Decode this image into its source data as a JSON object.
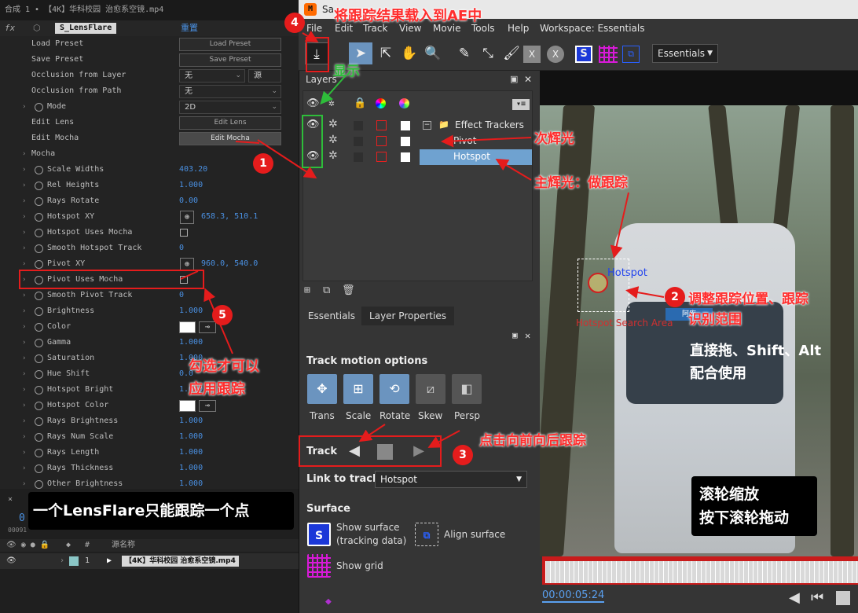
{
  "ae": {
    "top_bar": "合成 1 • 【4K】华科校园 治愈系空镜.mp4",
    "fx_label": "fx",
    "effect_name": "S_LensFlare",
    "reset": "重置",
    "rows": [
      {
        "label": "Load Preset",
        "type": "button",
        "button": "Load Preset"
      },
      {
        "label": "Save Preset",
        "type": "button",
        "button": "Save Preset"
      },
      {
        "label": "Occlusion from Layer",
        "type": "select2",
        "value": "无",
        "value2": "源"
      },
      {
        "label": "Occlusion from Path",
        "type": "select",
        "value": "无"
      },
      {
        "label": "Mode",
        "type": "select",
        "value": "2D",
        "stopwatch": true
      },
      {
        "label": "Edit Lens",
        "type": "button",
        "button": "Edit Lens"
      },
      {
        "label": "Edit Mocha",
        "type": "button-light",
        "button": "Edit Mocha"
      },
      {
        "label": "Mocha",
        "type": "group"
      },
      {
        "label": "Scale Widths",
        "type": "value",
        "value": "403.20"
      },
      {
        "label": "Rel Heights",
        "type": "value",
        "value": "1.000"
      },
      {
        "label": "Rays Rotate",
        "type": "value",
        "value": "0.00"
      },
      {
        "label": "Hotspot XY",
        "type": "point",
        "value": "658.3, 510.1"
      },
      {
        "label": "Hotspot Uses Mocha",
        "type": "checkbox"
      },
      {
        "label": "Smooth Hotspot Track",
        "type": "value",
        "value": "0"
      },
      {
        "label": "Pivot XY",
        "type": "point",
        "value": "960.0, 540.0"
      },
      {
        "label": "Pivot Uses Mocha",
        "type": "checkbox"
      },
      {
        "label": "Smooth Pivot Track",
        "type": "value",
        "value": "0"
      },
      {
        "label": "Brightness",
        "type": "value",
        "value": "1.000"
      },
      {
        "label": "Color",
        "type": "color"
      },
      {
        "label": "Gamma",
        "type": "value",
        "value": "1.000"
      },
      {
        "label": "Saturation",
        "type": "value",
        "value": "1.000"
      },
      {
        "label": "Hue Shift",
        "type": "value",
        "value": "0.0"
      },
      {
        "label": "Hotspot Bright",
        "type": "value",
        "value": "1.000"
      },
      {
        "label": "Hotspot Color",
        "type": "color"
      },
      {
        "label": "Rays Brightness",
        "type": "value",
        "value": "1.000"
      },
      {
        "label": "Rays Num Scale",
        "type": "value",
        "value": "1.000"
      },
      {
        "label": "Rays Length",
        "type": "value",
        "value": "1.000"
      },
      {
        "label": "Rays Thickness",
        "type": "value",
        "value": "1.000"
      },
      {
        "label": "Other Brightness",
        "type": "value",
        "value": "1.000"
      }
    ],
    "bottom_close": "×",
    "timecode": "0",
    "small_tc": "00091",
    "layer_header_name": "源名称",
    "layer_header_hash": "#",
    "layer_num": "1",
    "layer_name": "【4K】华科校园 治愈系空镜.mp4"
  },
  "mocha": {
    "logo": "M",
    "title": "Sa",
    "menu": [
      "File",
      "Edit",
      "Track",
      "View",
      "Movie",
      "Tools",
      "Help",
      "Workspace: Essentials"
    ],
    "workspace_select": "Essentials",
    "layers_title": "Layers",
    "layer_rows": [
      {
        "name": "Effect Trackers",
        "group": true
      },
      {
        "name": "Pivot"
      },
      {
        "name": "Hotspot",
        "selected": true
      }
    ],
    "tabs": [
      "Essentials",
      "Layer Properties"
    ],
    "track_motion_title": "Track motion options",
    "motion_buttons": [
      "Trans",
      "Scale",
      "Rotate",
      "Skew",
      "Persp"
    ],
    "track_label": "Track",
    "link_label": "Link to track",
    "link_value": "Hotspot",
    "surface_title": "Surface",
    "show_surface": "Show surface\n(tracking data)",
    "align_surface": "Align surface",
    "show_grid": "Show grid",
    "viewer_hotspot": "Hotspot",
    "viewer_search": "Hotspot Search Area",
    "bus_sign": "阿库",
    "timecode": "00:00:05:24"
  },
  "annotations": {
    "a1": "将跟踪结果载入到AE中",
    "a_show": "显示",
    "a_secondary": "次辉光",
    "a_main": "主辉光：做跟踪",
    "a_adjust": "调整跟踪位置、跟踪\n识别范围",
    "a_drag": "直接拖、Shift、Alt\n配合使用",
    "a_track": "点击向前向后跟踪",
    "a_check": "勾选才可以\n应用跟踪",
    "a_one": "一个LensFlare只能跟踪一个点",
    "a_wheel": "滚轮缩放\n按下滚轮拖动",
    "n1": "1",
    "n2": "2",
    "n3": "3",
    "n4": "4",
    "n5": "5"
  },
  "colors": {
    "accent_blue": "#4a90e2",
    "annotation_red": "#ff2e2e",
    "selection": "#6fa2d0",
    "green_box": "#2ebd3a"
  }
}
